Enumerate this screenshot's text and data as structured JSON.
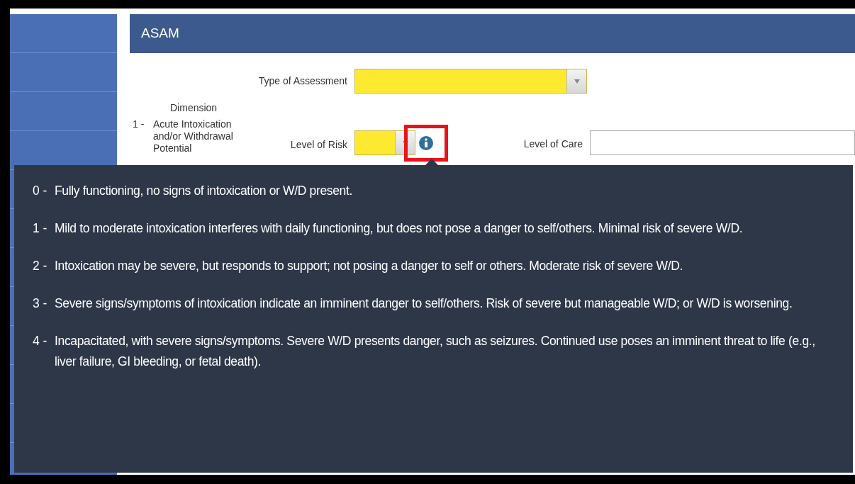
{
  "section": {
    "title": "ASAM"
  },
  "assessment_type": {
    "label": "Type of Assessment",
    "required": true
  },
  "dimension_heading": "Dimension",
  "dimension": {
    "number": "1 -",
    "name": "Acute Intoxication and/or Withdrawal Potential",
    "risk_label": "Level of Risk",
    "risk_required": true,
    "info_highlighted": true,
    "care_label": "Level of Care"
  },
  "tooltip": {
    "items": [
      {
        "number": "0 -",
        "text": "Fully functioning, no signs of intoxication or W/D present."
      },
      {
        "number": "1 -",
        "text": "Mild to moderate intoxication interferes with daily functioning, but does not pose a danger to self/others. Minimal risk of severe W/D."
      },
      {
        "number": "2 -",
        "text": "Intoxication may be severe, but responds to support; not posing a danger to self or others. Moderate risk of severe W/D."
      },
      {
        "number": "3 -",
        "text": "Severe signs/symptoms of intoxication indicate an imminent danger to self/others. Risk of severe but manageable W/D; or W/D is worsening."
      },
      {
        "number": "4 -",
        "text": "Incapacitated, with severe signs/symptoms. Severe W/D presents danger, such as seizures. Continued use poses an imminent threat to life (e.g., liver failure, GI bleeding, or fetal death)."
      }
    ]
  }
}
